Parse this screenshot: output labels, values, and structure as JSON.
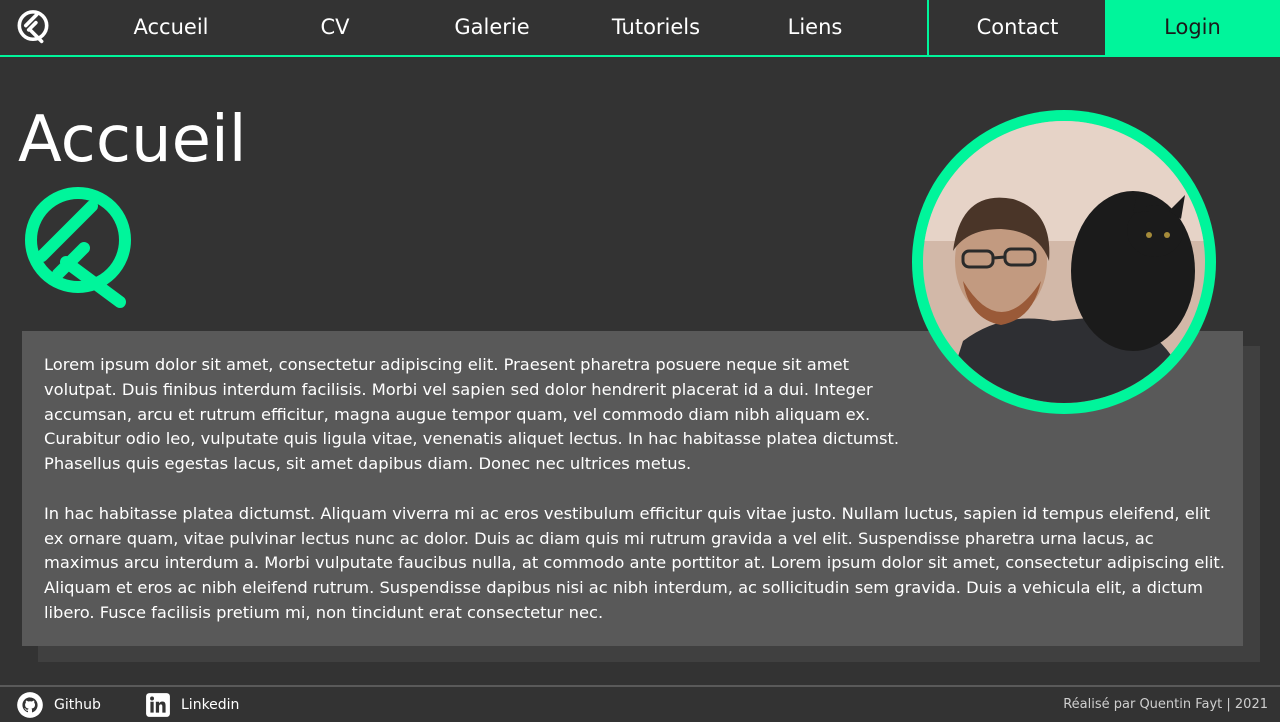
{
  "nav": {
    "items": [
      "Accueil",
      "CV",
      "Galerie",
      "Tutoriels",
      "Liens"
    ],
    "contact": "Contact",
    "login": "Login"
  },
  "page": {
    "title": "Accueil"
  },
  "content": {
    "paragraphs": [
      "Lorem ipsum dolor sit amet, consectetur adipiscing elit. Praesent pharetra posuere neque sit amet volutpat. Duis finibus interdum facilisis. Morbi vel sapien sed dolor hendrerit placerat id a dui. Integer accumsan, arcu et rutrum efficitur, magna augue tempor quam, vel commodo diam nibh aliquam ex. Curabitur odio leo, vulputate quis ligula vitae, venenatis aliquet lectus. In hac habitasse platea dictumst. Phasellus quis egestas lacus, sit amet dapibus diam. Donec nec ultrices metus.",
      "In hac habitasse platea dictumst. Aliquam viverra mi ac eros vestibulum efficitur quis vitae justo. Nullam luctus, sapien id tempus eleifend, elit ex ornare quam, vitae pulvinar lectus nunc ac dolor. Duis ac diam quis mi rutrum gravida a vel elit. Suspendisse pharetra urna lacus, ac maximus arcu interdum a. Morbi vulputate faucibus nulla, at commodo ante porttitor at. Lorem ipsum dolor sit amet, consectetur adipiscing elit. Aliquam et eros ac nibh eleifend rutrum. Suspendisse dapibus nisi ac nibh interdum, ac sollicitudin sem gravida. Duis a vehicula elit, a dictum libero. Fusce facilisis pretium mi, non tincidunt erat consectetur nec."
    ]
  },
  "footer": {
    "github": "Github",
    "linkedin": "Linkedin",
    "credit": "Réalisé par Quentin Fayt | 2021"
  },
  "icons": {
    "logo": "qf-logo-icon",
    "github": "github-icon",
    "linkedin": "linkedin-icon"
  },
  "colors": {
    "accent": "#00f59b",
    "background": "#333333",
    "panel": "#595959"
  }
}
